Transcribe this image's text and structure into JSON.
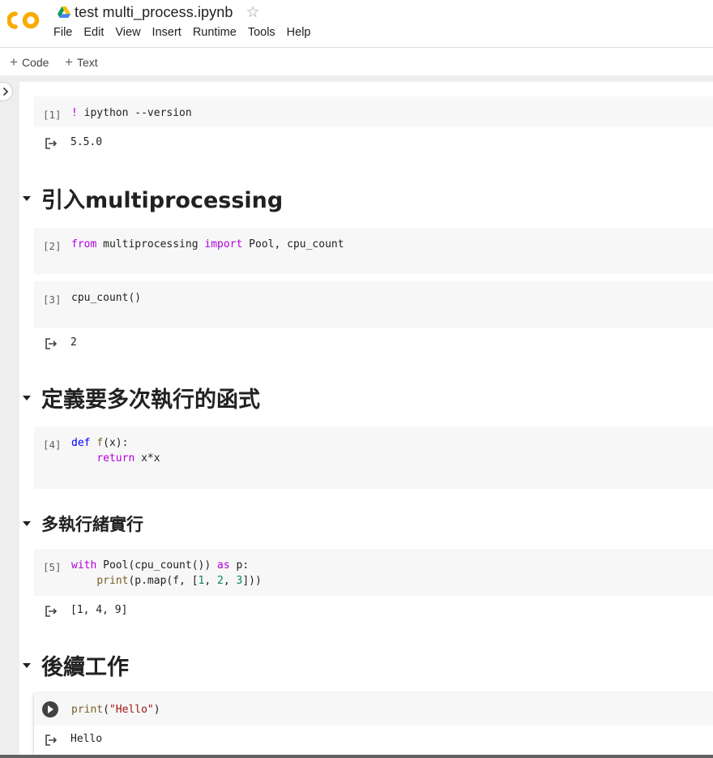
{
  "app": {
    "notebook_title": "test multi_process.ipynb",
    "star_icon": "star-outline-icon",
    "logo_text": "CO",
    "brand_color": "#f9ab00"
  },
  "menu": [
    "File",
    "Edit",
    "View",
    "Insert",
    "Runtime",
    "Tools",
    "Help"
  ],
  "toolbar": {
    "add_code_label": "Code",
    "add_text_label": "Text"
  },
  "cells": [
    {
      "exec": "[1]",
      "code": "! ipython --version",
      "output": "5.5.0"
    },
    {
      "exec": "[2]",
      "code": "from multiprocessing import Pool, cpu_count"
    },
    {
      "exec": "[3]",
      "code": "cpu_count()",
      "output": "2"
    },
    {
      "exec": "[4]",
      "code_lines": [
        "def f(x):",
        "    return x*x"
      ]
    },
    {
      "exec": "[5]",
      "code_lines": [
        "with Pool(cpu_count()) as p:",
        "    print(p.map(f, [1, 2, 3]))"
      ],
      "output": "[1, 4, 9]"
    },
    {
      "exec": "",
      "code": "print(\"Hello\")",
      "output": "Hello"
    }
  ],
  "headings": [
    {
      "text": "引入multiprocessing",
      "level": 1
    },
    {
      "text": "定義要多次執行的函式",
      "level": 1
    },
    {
      "text": "多執行緒實行",
      "level": 2
    },
    {
      "text": "後續工作",
      "level": 1
    }
  ]
}
